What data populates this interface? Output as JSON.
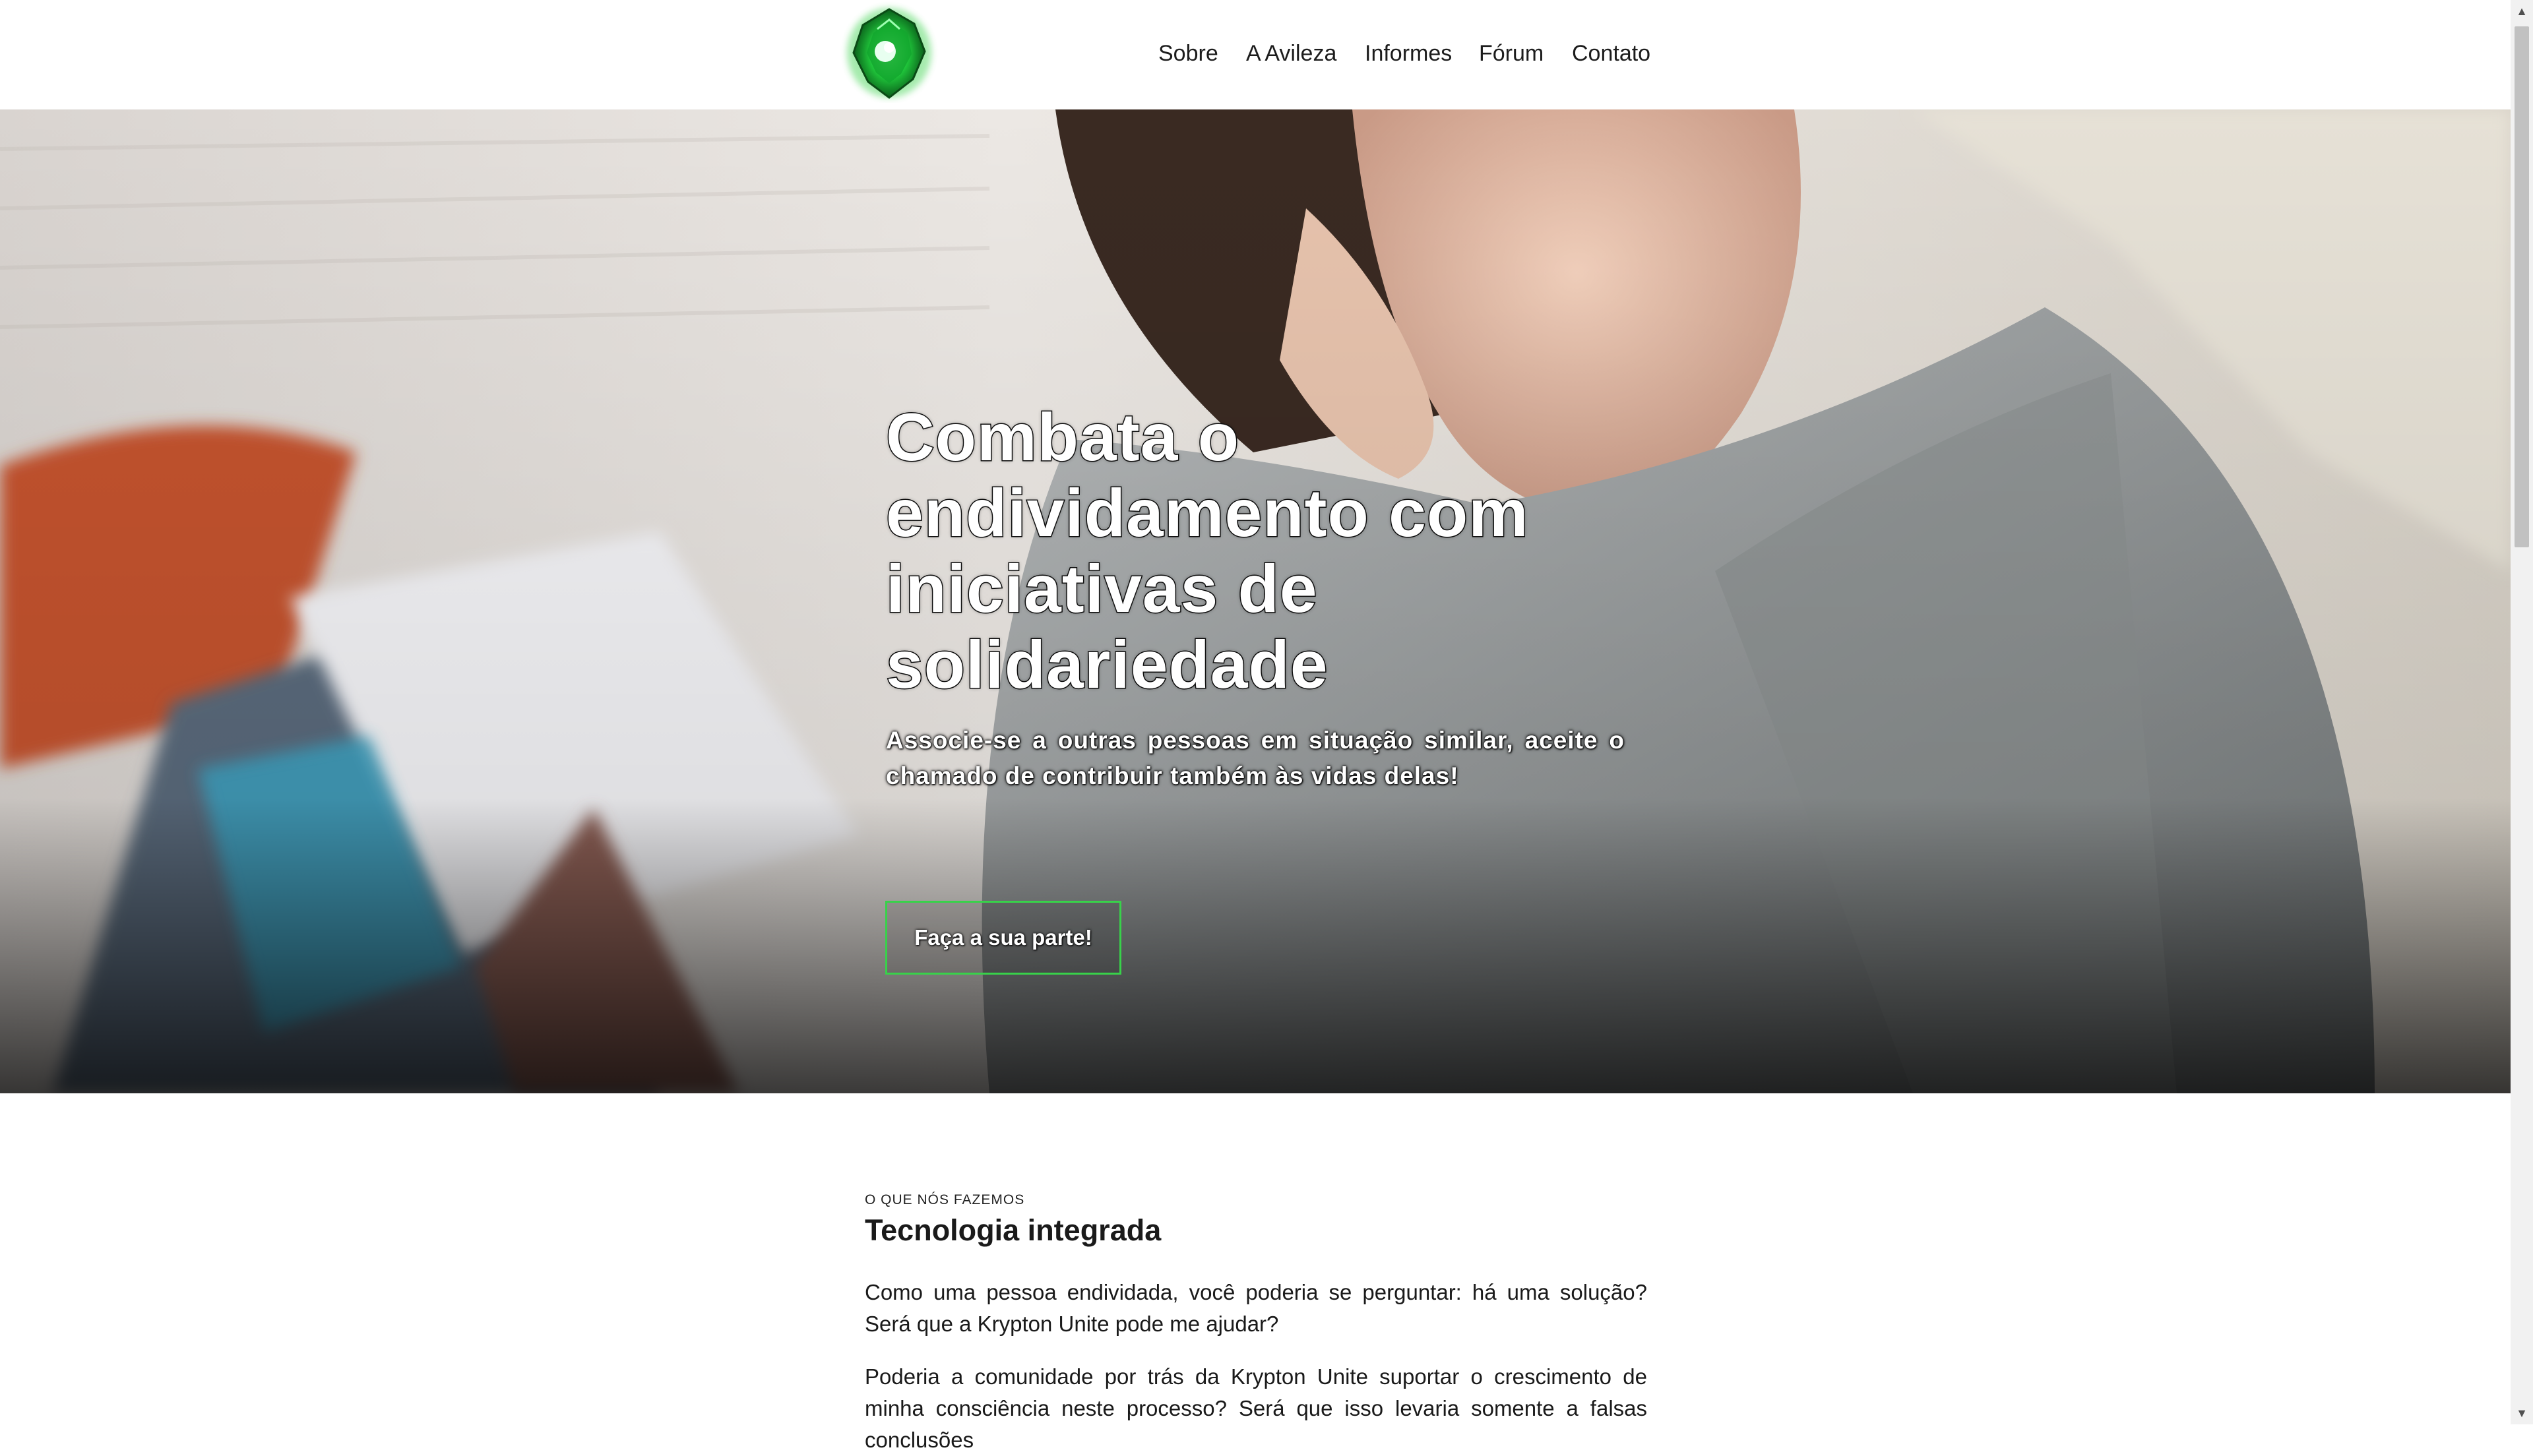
{
  "nav": {
    "items": [
      {
        "label": "Sobre"
      },
      {
        "label": "A Avileza"
      },
      {
        "label": "Informes"
      },
      {
        "label": "Fórum"
      },
      {
        "label": "Contato"
      }
    ]
  },
  "logo": {
    "icon": "green-gem-logo-icon"
  },
  "hero": {
    "title": "Combata o endividamento com iniciativas de solidariedade",
    "subtitle": "Associe-se a outras pessoas em situação similar, aceite o chamado de contribuir também às vidas delas!",
    "cta_label": "Faça a sua parte!"
  },
  "section": {
    "eyebrow": "O QUE NÓS FAZEMOS",
    "title": "Tecnologia integrada",
    "paragraph1": "Como uma pessoa endividada, você poderia se perguntar: há uma solução? Será que a Krypton Unite pode me ajudar?",
    "paragraph2": "Poderia a comunidade por trás da Krypton Unite suportar o crescimento de minha consciência neste processo? Será que isso levaria somente a falsas conclusões"
  },
  "colors": {
    "accent": "#38d24a",
    "text": "#1a1a1a"
  }
}
